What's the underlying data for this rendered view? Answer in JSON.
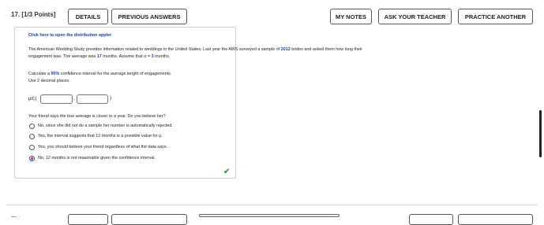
{
  "question": {
    "number_label": "17.  [1/3 Points]"
  },
  "toolbar": {
    "details": "DETAILS",
    "previous_answers": "PREVIOUS ANSWERS",
    "my_notes": "MY NOTES",
    "ask_teacher": "ASK YOUR TEACHER",
    "practice_another": "PRACTICE ANOTHER"
  },
  "content": {
    "applet_link": "Click here to open the distribution applet",
    "para1_a": "The American Wedding Study provides information related to weddings in the United States. Last year the AWS surveyed a sample of ",
    "para1_year": "2012",
    "para1_b": " brides and asked them how long their",
    "para2_a": "engagement was. The average was ",
    "para2_mean": "17",
    "para2_b": " months. Assume that σ = ",
    "para2_sigma": "3",
    "para2_c": " months.",
    "calc_a": "Calculate a ",
    "calc_conf": "95%",
    "calc_b": " confidence interval for the average length of engagements.",
    "decimals": "Use 2 decimal places.",
    "interval_prefix": "μ∈(",
    "interval_comma": ",",
    "interval_suffix": ")",
    "friend_question": "Your friend says the true average is closer to a year. Do you believe her?",
    "options": [
      "No, since she did not do a sample her number is automatically rejected.",
      "Yes, the interval suggests that 12 months is a possible value for μ.",
      "Yes, you should believe your friend regardless of what the data says.",
      "No, 12 months is not reasonable given the confidence interval."
    ],
    "selected_option": 3,
    "check_mark": "✔"
  }
}
